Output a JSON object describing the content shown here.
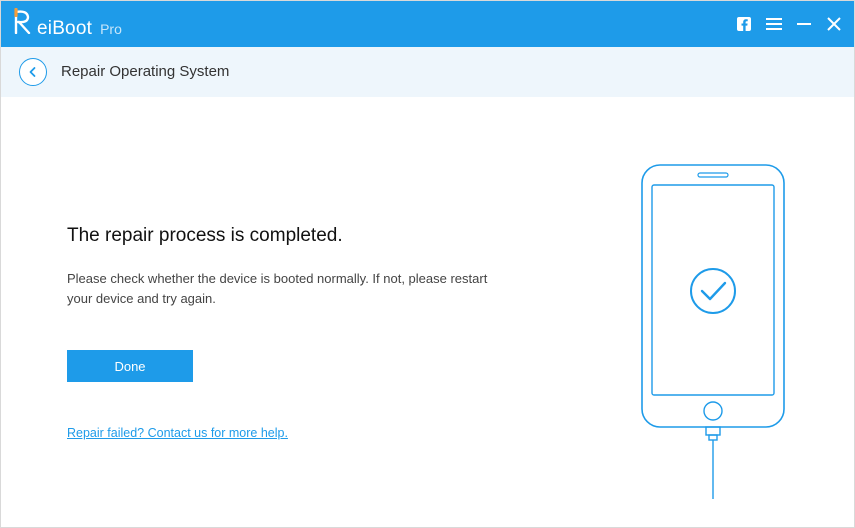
{
  "brand": {
    "name": "eiBoot",
    "suffix": "Pro"
  },
  "subheader": {
    "title": "Repair Operating System"
  },
  "main": {
    "headline": "The repair process is completed.",
    "body": "Please check whether the device is booted normally. If not, please restart your device and try again.",
    "done_label": "Done",
    "help_link": "Repair failed? Contact us for more help."
  }
}
